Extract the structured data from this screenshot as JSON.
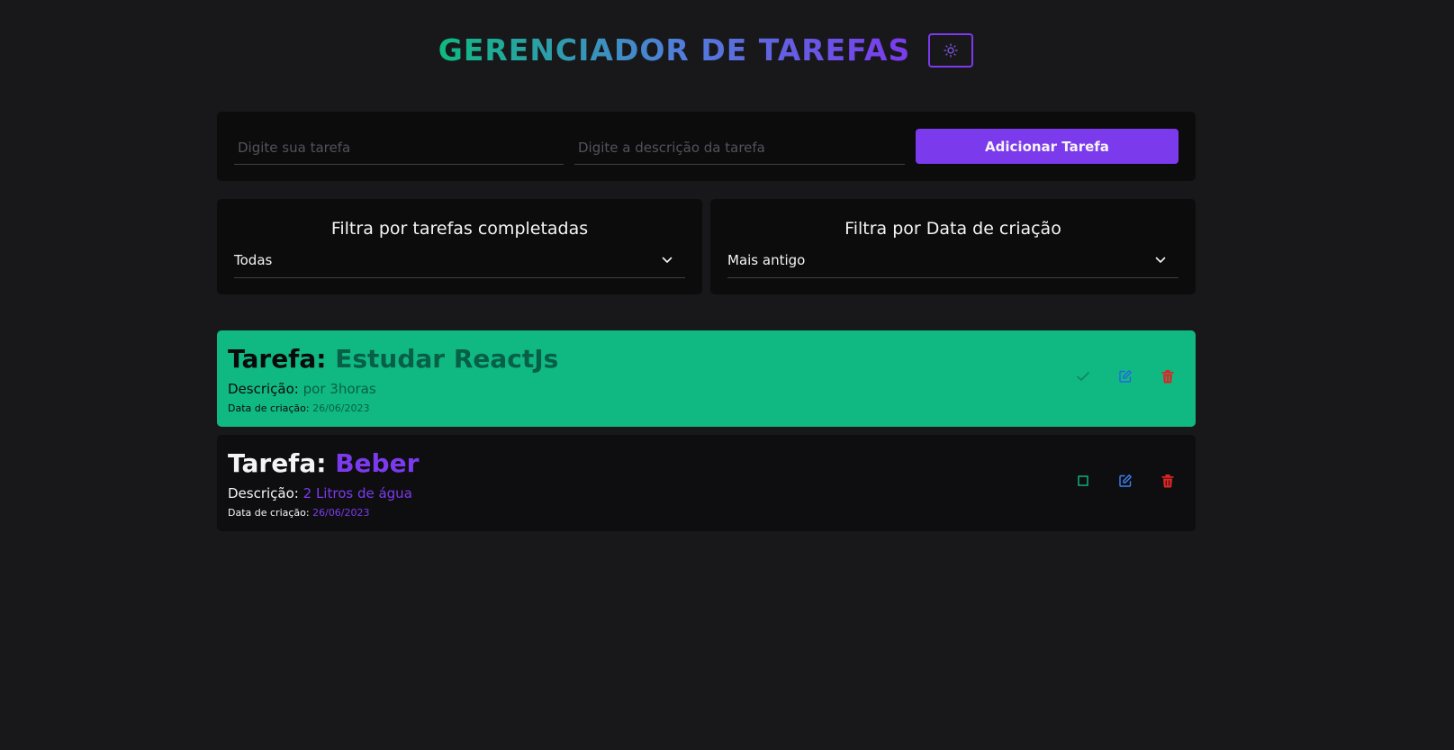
{
  "header": {
    "title": "GERENCIADOR DE TAREFAS",
    "theme_icon": "sun-icon"
  },
  "add_form": {
    "title_placeholder": "Digite sua tarefa",
    "title_value": "",
    "description_placeholder": "Digite a descrição da tarefa",
    "description_value": "",
    "submit_label": "Adicionar Tarefa"
  },
  "filters": {
    "completed": {
      "label": "Filtra por tarefas completadas",
      "selected": "Todas"
    },
    "created_date": {
      "label": "Filtra por Data de criação",
      "selected": "Mais antigo"
    }
  },
  "tasks": [
    {
      "title_label": "Tarefa:",
      "title": "Estudar ReactJs",
      "description_label": "Descrição:",
      "description": "por 3horas",
      "date_label": "Data de criação:",
      "date": "26/06/2023",
      "completed": true
    },
    {
      "title_label": "Tarefa:",
      "title": "Beber",
      "description_label": "Descrição:",
      "description": "2 Litros de água",
      "date_label": "Data de criação:",
      "date": "26/06/2023",
      "completed": false
    }
  ],
  "colors": {
    "background": "#18181b",
    "panel": "#0c0c0d",
    "accent": "#7c3aed",
    "done": "#10b981",
    "edit": "#3b82f6",
    "delete": "#dc2626"
  }
}
